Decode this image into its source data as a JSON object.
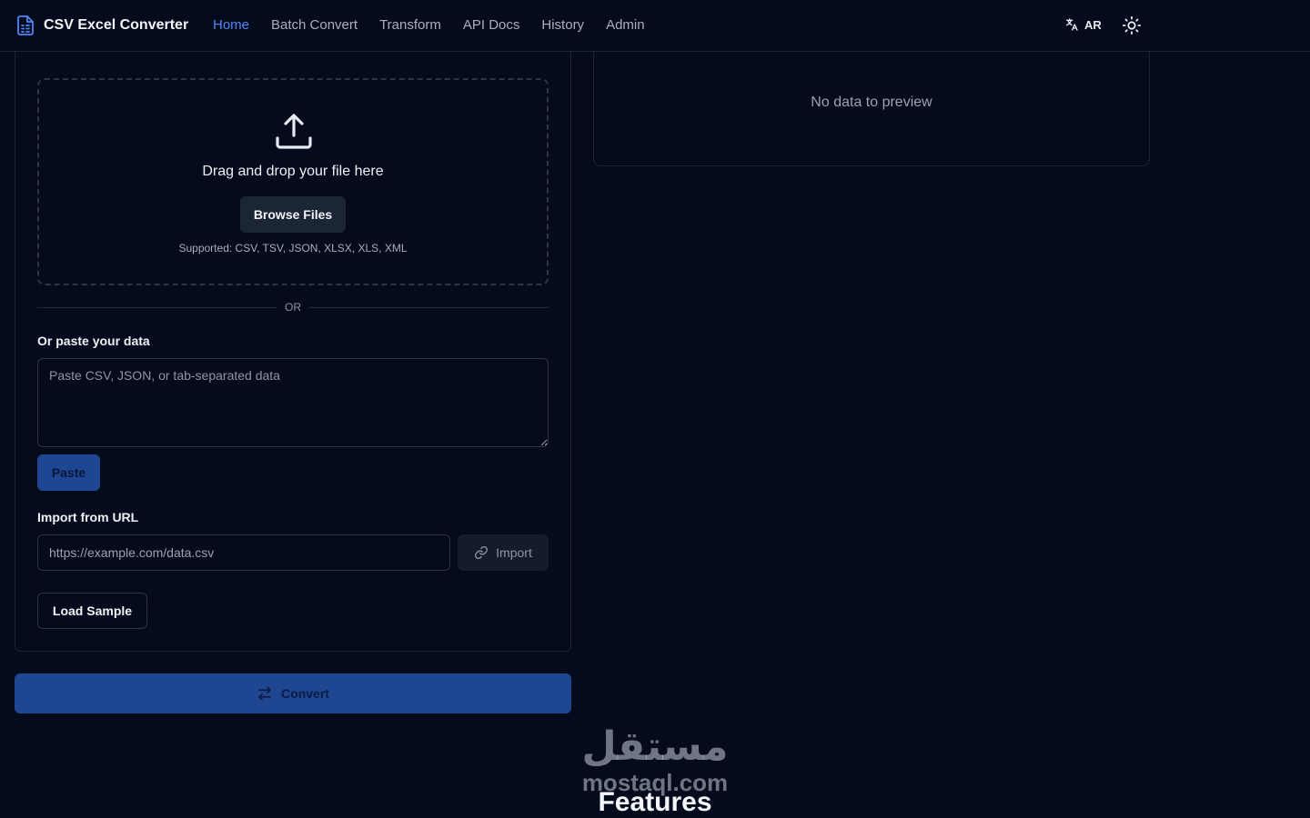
{
  "header": {
    "app_name": "CSV Excel Converter",
    "nav": [
      {
        "label": "Home",
        "active": true
      },
      {
        "label": "Batch Convert",
        "active": false
      },
      {
        "label": "Transform",
        "active": false
      },
      {
        "label": "API Docs",
        "active": false
      },
      {
        "label": "History",
        "active": false
      },
      {
        "label": "Admin",
        "active": false
      }
    ],
    "language_label": "AR",
    "icons": {
      "logo": "file-spreadsheet-icon",
      "language": "translate-icon",
      "theme": "sun-icon"
    }
  },
  "upload": {
    "drop_text": "Drag and drop your file here",
    "browse_label": "Browse Files",
    "supported_text": "Supported: CSV, TSV, JSON, XLSX, XLS, XML",
    "divider_text": "OR"
  },
  "paste": {
    "label": "Or paste your data",
    "placeholder": "Paste CSV, JSON, or tab-separated data",
    "button_label": "Paste"
  },
  "url_import": {
    "label": "Import from URL",
    "placeholder": "https://example.com/data.csv",
    "button_label": "Import"
  },
  "sample_label": "Load Sample",
  "convert_label": "Convert",
  "preview": {
    "empty_text": "No data to preview"
  },
  "features_heading": "Features",
  "watermark": {
    "arabic": "مستقل",
    "latin": "mostaql.com"
  },
  "colors": {
    "background": "#030b1c",
    "accent": "#4f86f7",
    "primary_button": "#1f4690",
    "border": "#2a3546"
  }
}
